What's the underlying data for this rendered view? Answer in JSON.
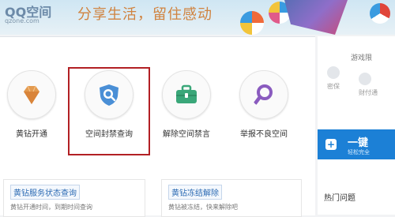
{
  "header": {
    "logo_title": "QQ空间",
    "logo_url": "qzone.com",
    "slogan": "分享生活，留住感动"
  },
  "services": [
    {
      "label": "黄钻开通",
      "icon": "diamond-icon",
      "color": "#e39a4f"
    },
    {
      "label": "空间封禁查询",
      "icon": "shield-search-icon",
      "color": "#4a8fd6"
    },
    {
      "label": "解除空间禁言",
      "icon": "toolbox-icon",
      "color": "#3aa779"
    },
    {
      "label": "举报不良空间",
      "icon": "search-magnifier-icon",
      "color": "#8a5bbf"
    }
  ],
  "cards": [
    {
      "title": "黄钻服务状态查询",
      "desc": "黄钻开通时间，到期时间查询"
    },
    {
      "title": "黄钻冻结解除",
      "desc": "黄钻被冻结，快来解除吧"
    }
  ],
  "sidebar": {
    "title": "游戏限",
    "item1": "密保",
    "item2": "财付通",
    "promo_title": "一键",
    "promo_sub": "轻松完全",
    "hot_title": "热门问题"
  },
  "colors": {
    "highlight": "#b22024",
    "promo": "#1c80d6",
    "link": "#2b6ab3"
  }
}
